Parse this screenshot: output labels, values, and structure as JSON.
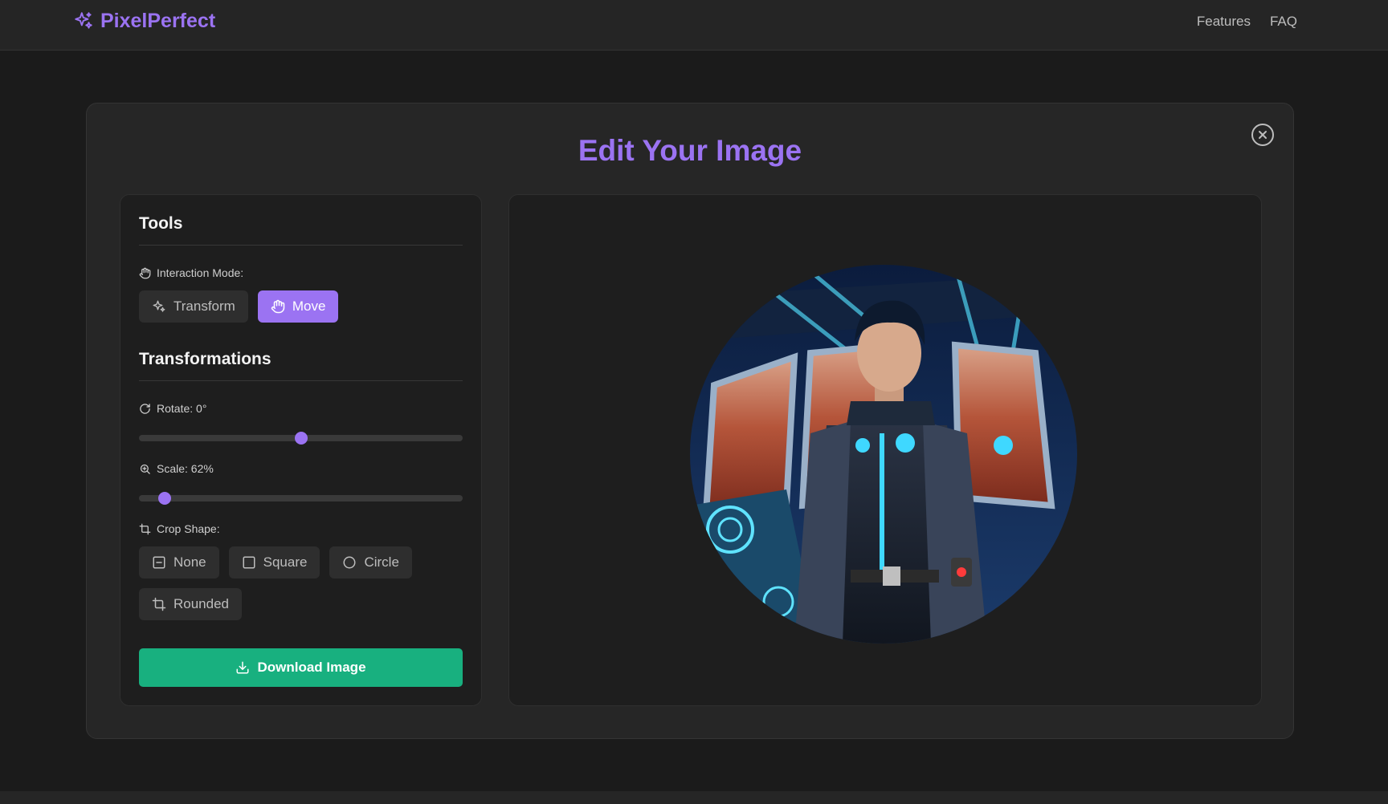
{
  "header": {
    "brand_name": "PixelPerfect",
    "brand_icon": "sparkles-icon",
    "nav": [
      {
        "label": "Features"
      },
      {
        "label": "FAQ"
      }
    ]
  },
  "modal": {
    "title": "Edit Your Image",
    "close_icon": "close-circle-icon"
  },
  "tools": {
    "heading": "Tools",
    "interaction_mode_label": "Interaction Mode:",
    "mode_buttons": [
      {
        "label": "Transform",
        "icon": "sparkles-icon",
        "active": false
      },
      {
        "label": "Move",
        "icon": "hand-icon",
        "active": true
      }
    ],
    "transformations_heading": "Transformations",
    "rotate": {
      "label": "Rotate: 0°",
      "value": 0,
      "min": -180,
      "max": 180
    },
    "scale": {
      "label": "Scale: 62%",
      "value": 62,
      "min": 50,
      "max": 200
    },
    "crop_label": "Crop Shape:",
    "crop_buttons": [
      {
        "label": "None",
        "icon": "square-minus-icon"
      },
      {
        "label": "Square",
        "icon": "square-icon"
      },
      {
        "label": "Circle",
        "icon": "circle-icon"
      },
      {
        "label": "Rounded",
        "icon": "crop-icon"
      }
    ],
    "download_label": "Download Image"
  },
  "colors": {
    "accent": "#9b73f2",
    "download": "#18b07f",
    "background": "#1b1b1b",
    "panel": "#1e1e1e"
  }
}
